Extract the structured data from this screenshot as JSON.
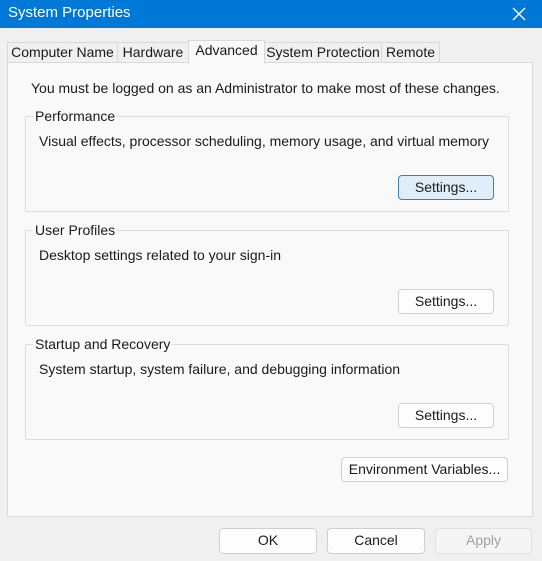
{
  "window": {
    "title": "System Properties"
  },
  "tabs": [
    {
      "label": "Computer Name",
      "active": false
    },
    {
      "label": "Hardware",
      "active": false
    },
    {
      "label": "Advanced",
      "active": true
    },
    {
      "label": "System Protection",
      "active": false
    },
    {
      "label": "Remote",
      "active": false
    }
  ],
  "advanced": {
    "admin_note": "You must be logged on as an Administrator to make most of these changes.",
    "performance": {
      "heading": "Performance",
      "description": "Visual effects, processor scheduling, memory usage, and virtual memory",
      "button": "Settings..."
    },
    "user_profiles": {
      "heading": "User Profiles",
      "description": "Desktop settings related to your sign-in",
      "button": "Settings..."
    },
    "startup_recovery": {
      "heading": "Startup and Recovery",
      "description": "System startup, system failure, and debugging information",
      "button": "Settings..."
    },
    "env_button": "Environment Variables..."
  },
  "footer": {
    "ok": "OK",
    "cancel": "Cancel",
    "apply": "Apply"
  },
  "colors": {
    "titlebar": "#0078d7",
    "focus_border": "#3c7fb1",
    "focus_fill": "#e0eef9"
  }
}
